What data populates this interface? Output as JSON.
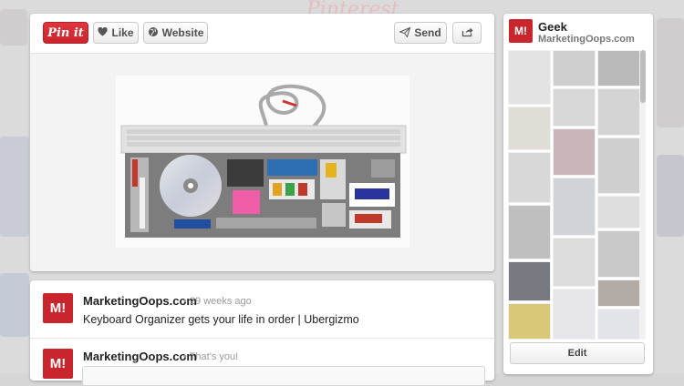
{
  "toolbar": {
    "pin_label": "Pin it",
    "like_label": "Like",
    "website_label": "Website",
    "send_label": "Send",
    "icons": {
      "like": "heart-icon",
      "website": "globe-icon",
      "send": "paper-plane-icon",
      "share": "share-icon"
    }
  },
  "backdrop": {
    "logo": "Pinterest"
  },
  "pin": {
    "image_alt": "Keyboard organizer with drawers of office supplies"
  },
  "comments": [
    {
      "avatar": "M!",
      "name": "MarketingOops.com",
      "meta": "• 29 weeks ago",
      "text": "Keyboard Organizer gets your life in order | Ubergizmo"
    },
    {
      "avatar": "M!",
      "name": "MarketingOops.com",
      "meta": "• That's you!"
    }
  ],
  "board": {
    "avatar": "M!",
    "title": "Geek",
    "owner": "MarketingOops.com",
    "edit_label": "Edit"
  },
  "colors": {
    "pinterest_red": "#c8252c",
    "card_bg": "#ffffff",
    "backdrop": "#dcdbdb"
  }
}
